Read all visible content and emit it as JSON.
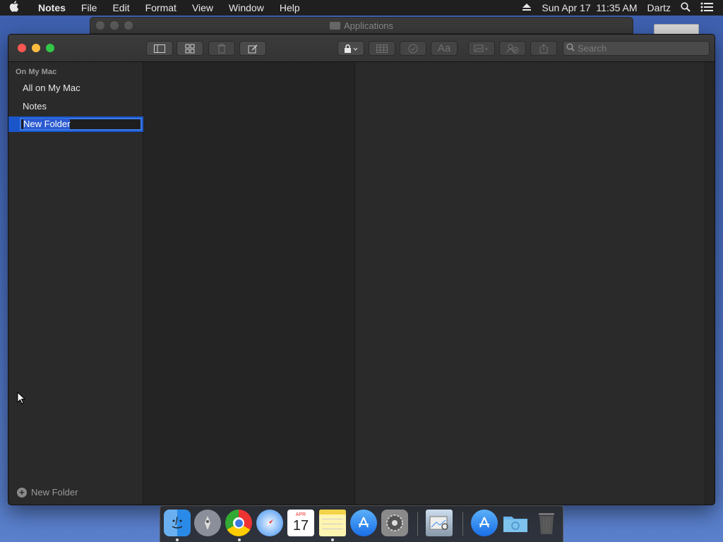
{
  "menubar": {
    "apple_icon": "apple-logo",
    "app_name": "Notes",
    "items": [
      "File",
      "Edit",
      "Format",
      "View",
      "Window",
      "Help"
    ],
    "datetime": "Sun Apr 17  11:35 AM",
    "user": "Dartz"
  },
  "background_window": {
    "title": "Applications"
  },
  "toolbar": {
    "search_placeholder": "Search"
  },
  "sidebar": {
    "section_title": "On My Mac",
    "items": [
      {
        "label": "All on My Mac"
      },
      {
        "label": "Notes"
      }
    ],
    "editing_value": "New Folder",
    "new_folder_label": "New Folder"
  },
  "dock": {
    "calendar_month": "APR",
    "calendar_day": "17"
  },
  "colors": {
    "selection": "#1a56c9",
    "close": "#fc5753",
    "minimize": "#fdbc40",
    "maximize": "#33c748"
  }
}
